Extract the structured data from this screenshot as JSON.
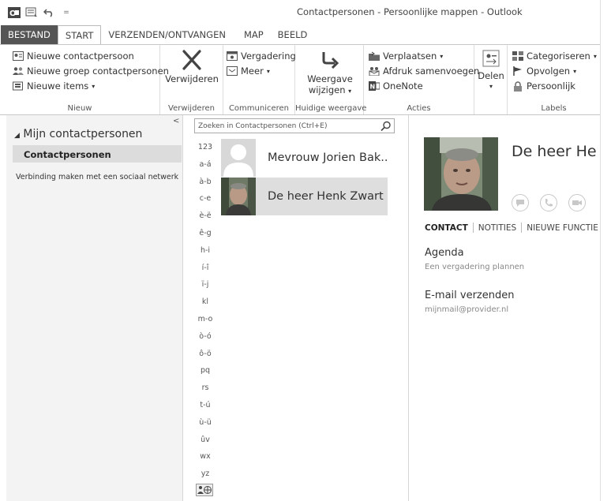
{
  "window": {
    "title": "Contactpersonen - Persoonlijke mappen - Outlook"
  },
  "tabs": [
    {
      "label": "BESTAND"
    },
    {
      "label": "START"
    },
    {
      "label": "VERZENDEN/ONTVANGEN"
    },
    {
      "label": "MAP"
    },
    {
      "label": "BEELD"
    }
  ],
  "ribbon": {
    "nieuw": {
      "label": "Nieuw",
      "new_contact": "Nieuwe contactpersoon",
      "new_group": "Nieuwe groep contactpersonen",
      "new_items": "Nieuwe items",
      "new_items_arrow": "▾"
    },
    "verwijderen": {
      "label": "Verwijderen",
      "button": "Verwijderen"
    },
    "communiceren": {
      "label": "Communiceren",
      "meeting": "Vergadering",
      "more": "Meer",
      "more_arrow": "▾"
    },
    "weergave": {
      "label": "Huidige weergave",
      "button_line1": "Weergave",
      "button_line2": "wijzigen",
      "arrow": "▾"
    },
    "acties": {
      "label": "Acties",
      "move": "Verplaatsen",
      "move_arrow": "▾",
      "mail_merge": "Afdruk samenvoegen",
      "onenote": "OneNote"
    },
    "delen": {
      "button": "Delen",
      "arrow": "▾"
    },
    "labels": {
      "label": "Labels",
      "categorize": "Categoriseren",
      "categorize_arrow": "▾",
      "follow_up": "Opvolgen",
      "follow_up_arrow": "▾",
      "private": "Persoonlijk"
    }
  },
  "nav": {
    "collapse": "<",
    "header": "Mijn contactpersonen",
    "header_arrow": "◢",
    "folder": "Contactpersonen",
    "social": "Verbinding maken met een sociaal netwerk"
  },
  "search": {
    "placeholder": "Zoeken in Contactpersonen (Ctrl+E)"
  },
  "alphabet": [
    "123",
    "a-á",
    "à-b",
    "c-e",
    "è-ë",
    "ê-g",
    "h-i",
    "í-î",
    "ï-j",
    "kl",
    "m-o",
    "ò-ó",
    "ô-ö",
    "pq",
    "rs",
    "t-ú",
    "ù-ü",
    "ûv",
    "wx",
    "yz"
  ],
  "contacts": [
    {
      "name": "Mevrouw Jorien Bak..."
    },
    {
      "name": "De heer Henk Zwart"
    }
  ],
  "reading": {
    "name": "De heer He",
    "tabs": [
      "CONTACT",
      "NOTITIES",
      "NIEUWE FUNCTIE"
    ],
    "agenda_title": "Agenda",
    "agenda_sub": "Een vergadering plannen",
    "email_title": "E-mail verzenden",
    "email_address": "mijnmail@provider.nl"
  },
  "colors": {
    "file_tab": "#555555",
    "selection": "#dedede",
    "nav_bg": "#f3f3f3"
  }
}
